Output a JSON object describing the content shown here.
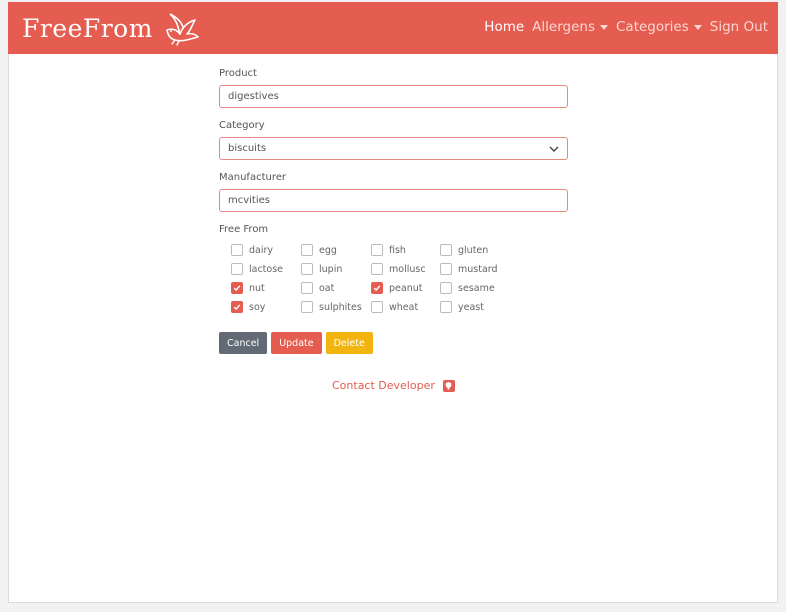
{
  "brand": {
    "name": "FreeFrom"
  },
  "nav": {
    "home": "Home",
    "allergens": "Allergens",
    "categories": "Categories",
    "signout": "Sign Out"
  },
  "form": {
    "product_label": "Product",
    "product_value": "digestives",
    "category_label": "Category",
    "category_value": "biscuits",
    "manufacturer_label": "Manufacturer",
    "manufacturer_value": "mcvities",
    "freefrom_label": "Free From",
    "allergens": [
      {
        "label": "dairy",
        "checked": false
      },
      {
        "label": "egg",
        "checked": false
      },
      {
        "label": "fish",
        "checked": false
      },
      {
        "label": "gluten",
        "checked": false
      },
      {
        "label": "lactose",
        "checked": false
      },
      {
        "label": "lupin",
        "checked": false
      },
      {
        "label": "mollusc",
        "checked": false
      },
      {
        "label": "mustard",
        "checked": false
      },
      {
        "label": "nut",
        "checked": true
      },
      {
        "label": "oat",
        "checked": false
      },
      {
        "label": "peanut",
        "checked": true
      },
      {
        "label": "sesame",
        "checked": false
      },
      {
        "label": "soy",
        "checked": true
      },
      {
        "label": "sulphites",
        "checked": false
      },
      {
        "label": "wheat",
        "checked": false
      },
      {
        "label": "yeast",
        "checked": false
      }
    ]
  },
  "buttons": {
    "cancel": "Cancel",
    "update": "Update",
    "delete": "Delete"
  },
  "footer": {
    "contact": "Contact Developer",
    "icon": "github-icon"
  },
  "colors": {
    "accent": "#e55c50",
    "cancel": "#616a75",
    "delete": "#f2b50f"
  }
}
